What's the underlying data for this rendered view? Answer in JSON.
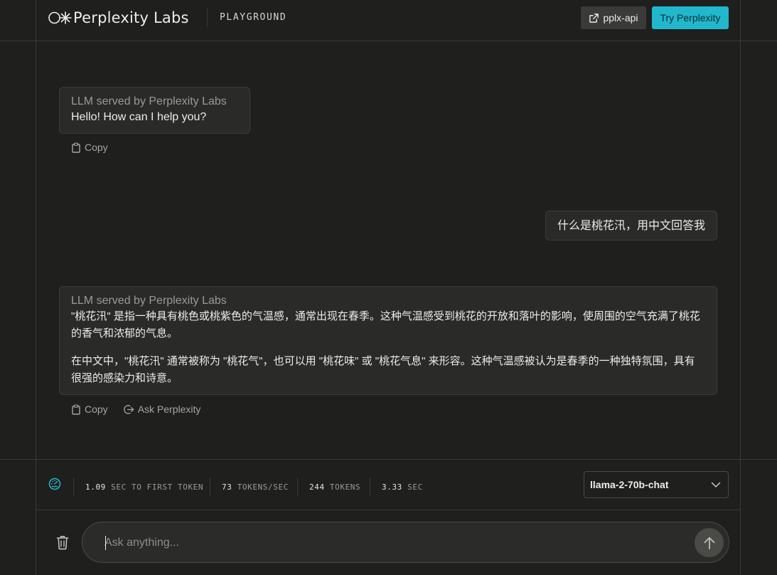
{
  "header": {
    "brand_name": "Perplexity Labs",
    "section": "PLAYGROUND",
    "api_button": "pplx-api",
    "try_button": "Try Perplexity"
  },
  "messages": [
    {
      "role": "assistant",
      "source": "LLM served by Perplexity Labs",
      "paragraphs": [
        "Hello! How can I help you?"
      ],
      "actions": [
        "Copy"
      ]
    },
    {
      "role": "user",
      "text": "什么是桃花汛，用中文回答我"
    },
    {
      "role": "assistant",
      "source": "LLM served by Perplexity Labs",
      "paragraphs": [
        "\"桃花汛\" 是指一种具有桃色或桃紫色的气温感，通常出现在春季。这种气温感受到桃花的开放和落叶的影响，使周围的空气充满了桃花的香气和浓郁的气息。",
        "在中文中，\"桃花汛\" 通常被称为 \"桃花气\"，也可以用 \"桃花味\" 或 \"桃花气息\" 来形容。这种气温感被认为是春季的一种独特氛围，具有很强的感染力和诗意。"
      ],
      "actions": [
        "Copy",
        "Ask Perplexity"
      ]
    }
  ],
  "stats": [
    {
      "value": "1.09",
      "label": "SEC TO FIRST TOKEN"
    },
    {
      "value": "73",
      "label": "TOKENS/SEC"
    },
    {
      "value": "244",
      "label": "TOKENS"
    },
    {
      "value": "3.33",
      "label": "SEC"
    }
  ],
  "model": {
    "selected": "llama-2-70b-chat"
  },
  "input": {
    "placeholder": "Ask anything...",
    "value": ""
  },
  "colors": {
    "background": "#1f1f1d",
    "accent": "#21b8cd",
    "bubble": "#2a2a28",
    "border": "#3a3a38"
  },
  "icons": {
    "brand": "perplexity-logo",
    "api": "external-link-icon",
    "copy": "clipboard-icon",
    "ask": "share-arrow-icon",
    "stats": "speedometer-icon",
    "model": "chevron-down-icon",
    "clear": "trash-icon",
    "send": "arrow-up-icon"
  }
}
